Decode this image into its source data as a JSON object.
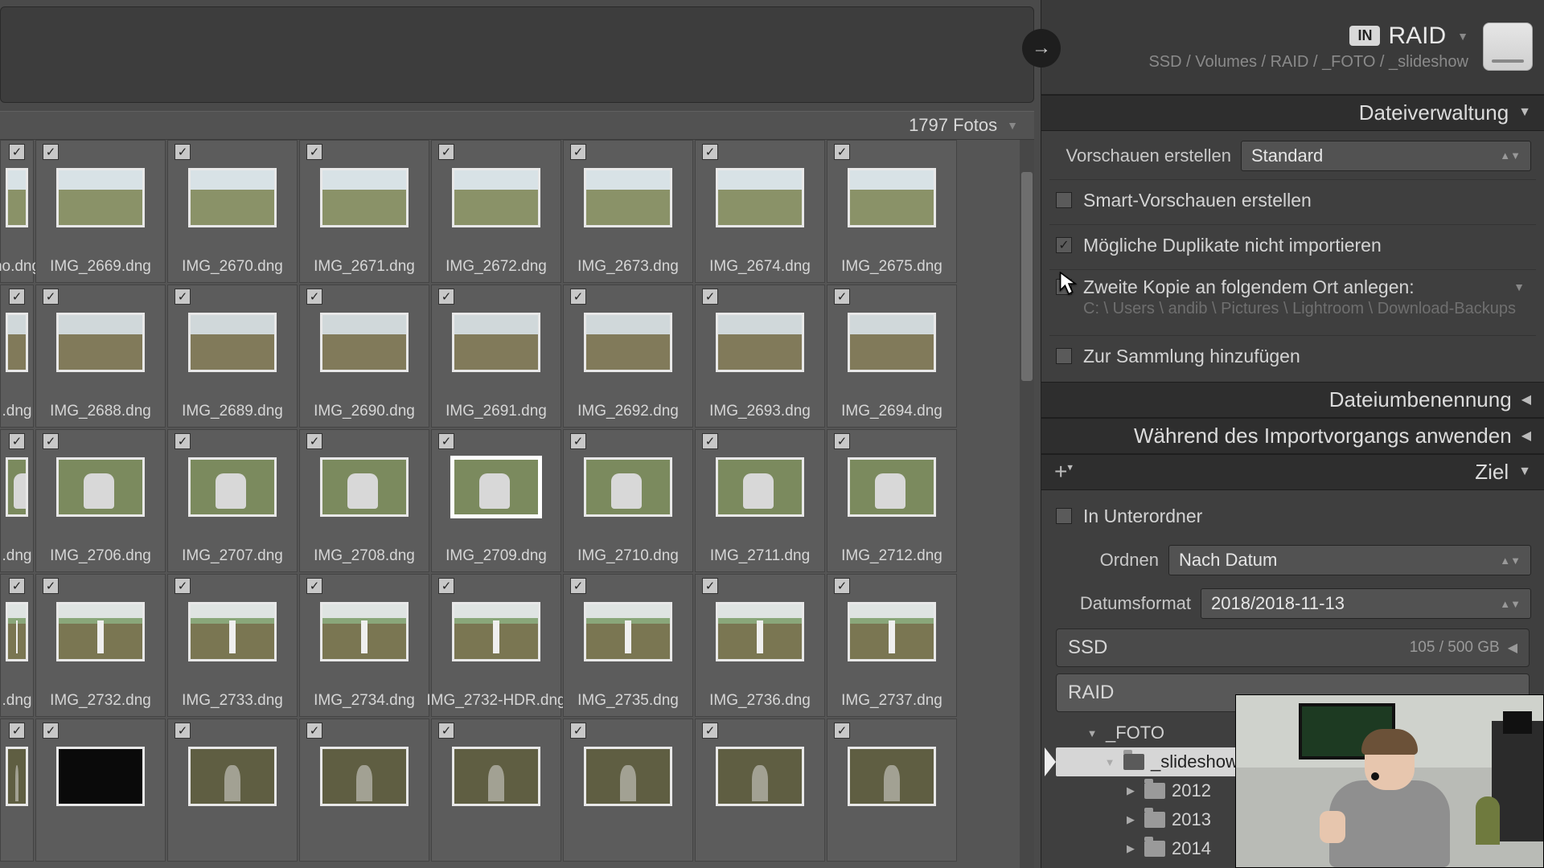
{
  "header": {
    "in_badge": "IN",
    "destination_name": "RAID",
    "destination_path": "SSD / Volumes / RAID / _FOTO / _slideshow"
  },
  "count_bar": {
    "text": "1797 Fotos"
  },
  "thumbs": {
    "rows": [
      {
        "style": "land",
        "first": "no.dng",
        "items": [
          {
            "f": "IMG_2669.dng"
          },
          {
            "f": "IMG_2670.dng"
          },
          {
            "f": "IMG_2671.dng"
          },
          {
            "f": "IMG_2672.dng"
          },
          {
            "f": "IMG_2673.dng"
          },
          {
            "f": "IMG_2674.dng"
          },
          {
            "f": "IMG_2675.dng"
          }
        ]
      },
      {
        "style": "hill",
        "first": ".dng",
        "items": [
          {
            "f": "IMG_2688.dng"
          },
          {
            "f": "IMG_2689.dng"
          },
          {
            "f": "IMG_2690.dng"
          },
          {
            "f": "IMG_2691.dng"
          },
          {
            "f": "IMG_2692.dng"
          },
          {
            "f": "IMG_2693.dng"
          },
          {
            "f": "IMG_2694.dng"
          }
        ]
      },
      {
        "style": "people",
        "first": ".dng",
        "sel": 3,
        "items": [
          {
            "f": "IMG_2706.dng"
          },
          {
            "f": "IMG_2707.dng"
          },
          {
            "f": "IMG_2708.dng"
          },
          {
            "f": "IMG_2709.dng"
          },
          {
            "f": "IMG_2710.dng"
          },
          {
            "f": "IMG_2711.dng"
          },
          {
            "f": "IMG_2712.dng"
          }
        ]
      },
      {
        "style": "canyon",
        "first": ".dng",
        "items": [
          {
            "f": "IMG_2732.dng"
          },
          {
            "f": "IMG_2733.dng"
          },
          {
            "f": "IMG_2734.dng"
          },
          {
            "f": "IMG_2732-HDR.dng"
          },
          {
            "f": "IMG_2735.dng"
          },
          {
            "f": "IMG_2736.dng"
          },
          {
            "f": "IMG_2737.dng"
          }
        ]
      },
      {
        "style": "stream",
        "first": "",
        "dark0": true,
        "items": [
          {
            "f": ""
          },
          {
            "f": ""
          },
          {
            "f": ""
          },
          {
            "f": ""
          },
          {
            "f": ""
          },
          {
            "f": ""
          },
          {
            "f": ""
          }
        ]
      }
    ]
  },
  "sections": {
    "file_handling": "Dateiverwaltung",
    "file_renaming": "Dateiumbenennung",
    "apply_during": "Während des Importvorgangs anwenden",
    "destination": "Ziel"
  },
  "file_handling": {
    "build_previews_label": "Vorschauen erstellen",
    "build_previews_value": "Standard",
    "smart_previews": "Smart-Vorschauen erstellen",
    "no_duplicates": "Mögliche Duplikate nicht importieren",
    "second_copy": "Zweite Kopie an folgendem Ort anlegen:",
    "second_copy_path": "C: \\ Users \\ andib \\ Pictures \\ Lightroom \\ Download-Backups",
    "add_to_collection": "Zur Sammlung hinzufügen"
  },
  "destination": {
    "into_subfolder": "In Unterordner",
    "organize_label": "Ordnen",
    "organize_value": "Nach Datum",
    "dateformat_label": "Datumsformat",
    "dateformat_value": "2018/2018-11-13",
    "disks": [
      {
        "name": "SSD",
        "cap": "105 / 500 GB"
      },
      {
        "name": "RAID",
        "cap": ""
      }
    ],
    "tree": {
      "root": "_FOTO",
      "selected": "_slideshow",
      "years": [
        "2012",
        "2013",
        "2014"
      ]
    }
  }
}
